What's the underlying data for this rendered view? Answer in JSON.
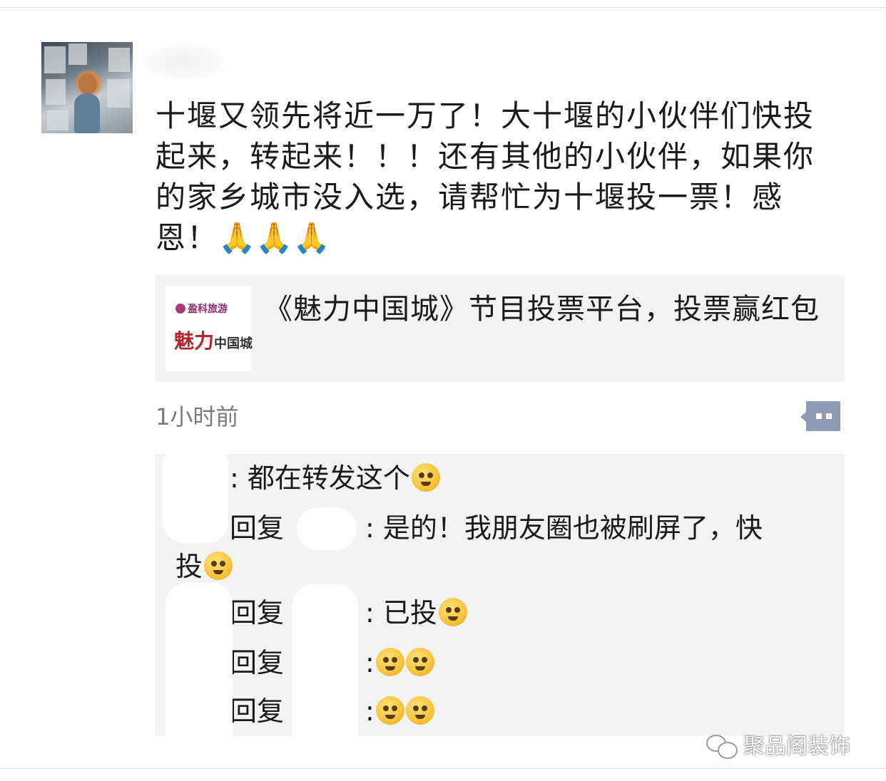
{
  "post": {
    "text_main": "十堰又领先将近一万了！大十堰的小伙伴们快投起来，转起来！！！还有其他的小伙伴，如果你的家乡城市没入选，请帮忙为十堰投一票！感恩！",
    "emojis": "🙏🙏🙏"
  },
  "link_card": {
    "title": "《魅力中国城》节目投票平台，投票赢红包",
    "thumb_brand": "盈科旅游",
    "thumb_logo_a": "魅力",
    "thumb_logo_b": "中国城"
  },
  "timestamp": "1小时前",
  "comments": [
    {
      "reply_word": "",
      "text": ": 都在转发这个"
    },
    {
      "reply_word": "回复",
      "text": ": 是的！我朋友圈也被刷屏了，快",
      "text2": "投"
    },
    {
      "reply_word": "回复",
      "text": ": 已投"
    },
    {
      "reply_word": "回复",
      "text": ":"
    },
    {
      "reply_word": "回复",
      "text": ":"
    }
  ],
  "watermark": "聚品阁装饰",
  "icons": {
    "avatar": "user-avatar",
    "comment": "comment-more-icon",
    "pray": "pray-emoji"
  }
}
